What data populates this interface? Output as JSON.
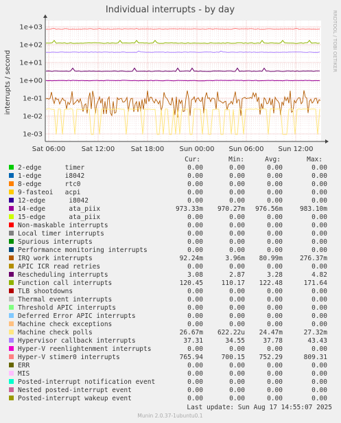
{
  "chart_data": {
    "type": "line",
    "title": "Individual interrupts - by day",
    "ylabel": "interrupts / second",
    "side_label": "RRDTOOL / TOBI OETIKER",
    "y_scale": "log",
    "y_ticks": [
      "1e-03",
      "1e-02",
      "1e-01",
      "1e+00",
      "1e+01",
      "1e+02",
      "1e+03"
    ],
    "x_ticks": [
      "Sat 06:00",
      "Sat 12:00",
      "Sat 18:00",
      "Sun 00:00",
      "Sun 06:00",
      "Sun 12:00"
    ],
    "grid": true,
    "legend_position": "below",
    "headers": {
      "cur": "Cur:",
      "min": "Min:",
      "avg": "Avg:",
      "max": "Max:"
    },
    "series": [
      {
        "name": "2-edge      timer",
        "color": "#00cc00",
        "cur": "0.00",
        "min": "0.00",
        "avg": "0.00",
        "max": "0.00"
      },
      {
        "name": "1-edge      i8042",
        "color": "#0066b3",
        "cur": "0.00",
        "min": "0.00",
        "avg": "0.00",
        "max": "0.00"
      },
      {
        "name": "8-edge      rtc0",
        "color": "#ff8000",
        "cur": "0.00",
        "min": "0.00",
        "avg": "0.00",
        "max": "0.00"
      },
      {
        "name": "9-fasteoi   acpi",
        "color": "#ffcc00",
        "cur": "0.00",
        "min": "0.00",
        "avg": "0.00",
        "max": "0.00"
      },
      {
        "name": "12-edge      i8042",
        "color": "#330099",
        "cur": "0.00",
        "min": "0.00",
        "avg": "0.00",
        "max": "0.00"
      },
      {
        "name": "14-edge      ata_piix",
        "color": "#990099",
        "cur": "973.33m",
        "min": "970.27m",
        "avg": "976.56m",
        "max": "983.10m"
      },
      {
        "name": "15-edge      ata_piix",
        "color": "#ccff00",
        "cur": "0.00",
        "min": "0.00",
        "avg": "0.00",
        "max": "0.00"
      },
      {
        "name": "Non-maskable interrupts",
        "color": "#ff0000",
        "cur": "0.00",
        "min": "0.00",
        "avg": "0.00",
        "max": "0.00"
      },
      {
        "name": "Local timer interrupts",
        "color": "#808080",
        "cur": "0.00",
        "min": "0.00",
        "avg": "0.00",
        "max": "0.00"
      },
      {
        "name": "Spurious interrupts",
        "color": "#008f00",
        "cur": "0.00",
        "min": "0.00",
        "avg": "0.00",
        "max": "0.00"
      },
      {
        "name": "Performance monitoring interrupts",
        "color": "#00487d",
        "cur": "0.00",
        "min": "0.00",
        "avg": "0.00",
        "max": "0.00"
      },
      {
        "name": "IRQ work interrupts",
        "color": "#b35a00",
        "cur": "92.24m",
        "min": "3.96m",
        "avg": "80.99m",
        "max": "276.37m"
      },
      {
        "name": "APIC ICR read retries",
        "color": "#b38f00",
        "cur": "0.00",
        "min": "0.00",
        "avg": "0.00",
        "max": "0.00"
      },
      {
        "name": "Rescheduling interrupts",
        "color": "#6b006b",
        "cur": "3.08",
        "min": "2.87",
        "avg": "3.28",
        "max": "4.82"
      },
      {
        "name": "Function call interrupts",
        "color": "#8fb300",
        "cur": "120.45",
        "min": "110.17",
        "avg": "122.48",
        "max": "171.64"
      },
      {
        "name": "TLB shootdowns",
        "color": "#b30000",
        "cur": "0.00",
        "min": "0.00",
        "avg": "0.00",
        "max": "0.00"
      },
      {
        "name": "Thermal event interrupts",
        "color": "#bebebe",
        "cur": "0.00",
        "min": "0.00",
        "avg": "0.00",
        "max": "0.00"
      },
      {
        "name": "Threshold APIC interrupts",
        "color": "#80ff80",
        "cur": "0.00",
        "min": "0.00",
        "avg": "0.00",
        "max": "0.00"
      },
      {
        "name": "Deferred Error APIC interrupts",
        "color": "#80c9ff",
        "cur": "0.00",
        "min": "0.00",
        "avg": "0.00",
        "max": "0.00"
      },
      {
        "name": "Machine check exceptions",
        "color": "#ffc080",
        "cur": "0.00",
        "min": "0.00",
        "avg": "0.00",
        "max": "0.00"
      },
      {
        "name": "Machine check polls",
        "color": "#ffe680",
        "cur": "26.67m",
        "min": "622.22u",
        "avg": "24.47m",
        "max": "27.32m"
      },
      {
        "name": "Hypervisor callback interrupts",
        "color": "#aa80ff",
        "cur": "37.31",
        "min": "34.55",
        "avg": "37.78",
        "max": "43.43"
      },
      {
        "name": "Hyper-V reenlightenment interrupts",
        "color": "#ee00cc",
        "cur": "0.00",
        "min": "0.00",
        "avg": "0.00",
        "max": "0.00"
      },
      {
        "name": "Hyper-V stimer0 interrupts",
        "color": "#ff8080",
        "cur": "765.94",
        "min": "700.15",
        "avg": "752.29",
        "max": "809.31"
      },
      {
        "name": "ERR",
        "color": "#666600",
        "cur": "0.00",
        "min": "0.00",
        "avg": "0.00",
        "max": "0.00"
      },
      {
        "name": "MIS",
        "color": "#ffbfff",
        "cur": "0.00",
        "min": "0.00",
        "avg": "0.00",
        "max": "0.00"
      },
      {
        "name": "Posted-interrupt notification event",
        "color": "#00ffcc",
        "cur": "0.00",
        "min": "0.00",
        "avg": "0.00",
        "max": "0.00"
      },
      {
        "name": "Nested posted-interrupt event",
        "color": "#cc6699",
        "cur": "0.00",
        "min": "0.00",
        "avg": "0.00",
        "max": "0.00"
      },
      {
        "name": "Posted-interrupt wakeup event",
        "color": "#999900",
        "cur": "0.00",
        "min": "0.00",
        "avg": "0.00",
        "max": "0.00"
      }
    ],
    "last_update": "Last update: Sun Aug 17 14:55:07 2025",
    "footer": "Munin 2.0.37-1ubuntu0.1"
  }
}
